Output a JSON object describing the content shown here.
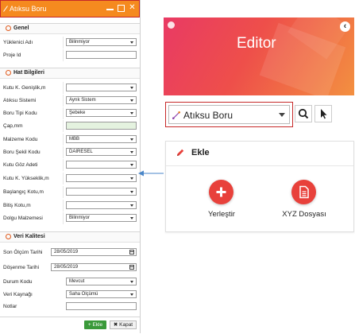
{
  "form": {
    "title": "Atıksu Boru",
    "sections": {
      "genel": "Genel",
      "hat": "Hat Bilgileri",
      "veri": "Veri Kalitesi"
    },
    "fields": {
      "yuklenici_adi": {
        "label": "Yüklenici Adı",
        "value": "Bilinmiyor"
      },
      "proje_id": {
        "label": "Proje Id",
        "value": ""
      },
      "kutu_k_genislik": {
        "label": "Kutu K. Genişlik,m",
        "value": ""
      },
      "atiksu_sistemi": {
        "label": "Atıksu Sistemi",
        "value": "Ayrık Sistem"
      },
      "boru_tipi_kodu": {
        "label": "Boru Tipi Kodu",
        "value": "Şebeke"
      },
      "cap_mm": {
        "label": "Çap,mm",
        "value": ""
      },
      "malzeme_kodu": {
        "label": "Malzeme Kodu",
        "value": "MBB"
      },
      "boru_sekil_kodu": {
        "label": "Boru Şekil Kodu",
        "value": "DAİRESEL"
      },
      "kutu_goz_adeti": {
        "label": "Kutu Göz Adeti",
        "value": ""
      },
      "kutu_k_yukseklik": {
        "label": "Kutu K. Yükseklik,m",
        "value": ""
      },
      "baslangic_kotu": {
        "label": "Başlangıç Kotu,m",
        "value": ""
      },
      "bitis_kotu": {
        "label": "Bitiş Kotu,m",
        "value": ""
      },
      "dolgu_malzemesi": {
        "label": "Dolgu Malzemesi",
        "value": "Bilinmiyor"
      },
      "son_olcum_tarihi": {
        "label": "Son Ölçüm Tarihi",
        "value": "28/05/2019"
      },
      "doseme_tarihi": {
        "label": "Döşenme Tarihi",
        "value": "28/05/2019"
      },
      "durum_kodu": {
        "label": "Durum Kodu",
        "value": "Mevcut"
      },
      "veri_kaynagi": {
        "label": "Veri Kaynağı",
        "value": "Saha Ölçümü"
      },
      "notlar": {
        "label": "Notlar",
        "value": ""
      }
    },
    "buttons": {
      "ekle": "+ Ekle",
      "kapat": "✖ Kapat"
    }
  },
  "editor": {
    "title": "Editor",
    "layer_select": {
      "value": "Atıksu Boru"
    },
    "card": {
      "title": "Ekle",
      "actions": [
        {
          "label": "Yerleştir",
          "icon": "plus-icon"
        },
        {
          "label": "XYZ Dosyası",
          "icon": "document-icon"
        }
      ]
    }
  },
  "colors": {
    "titlebar": "#f58a1f",
    "highlight_border": "#c62828",
    "accent_red": "#e8413b",
    "connector": "#4a86c8",
    "ekle_green": "#3a9a3a"
  }
}
